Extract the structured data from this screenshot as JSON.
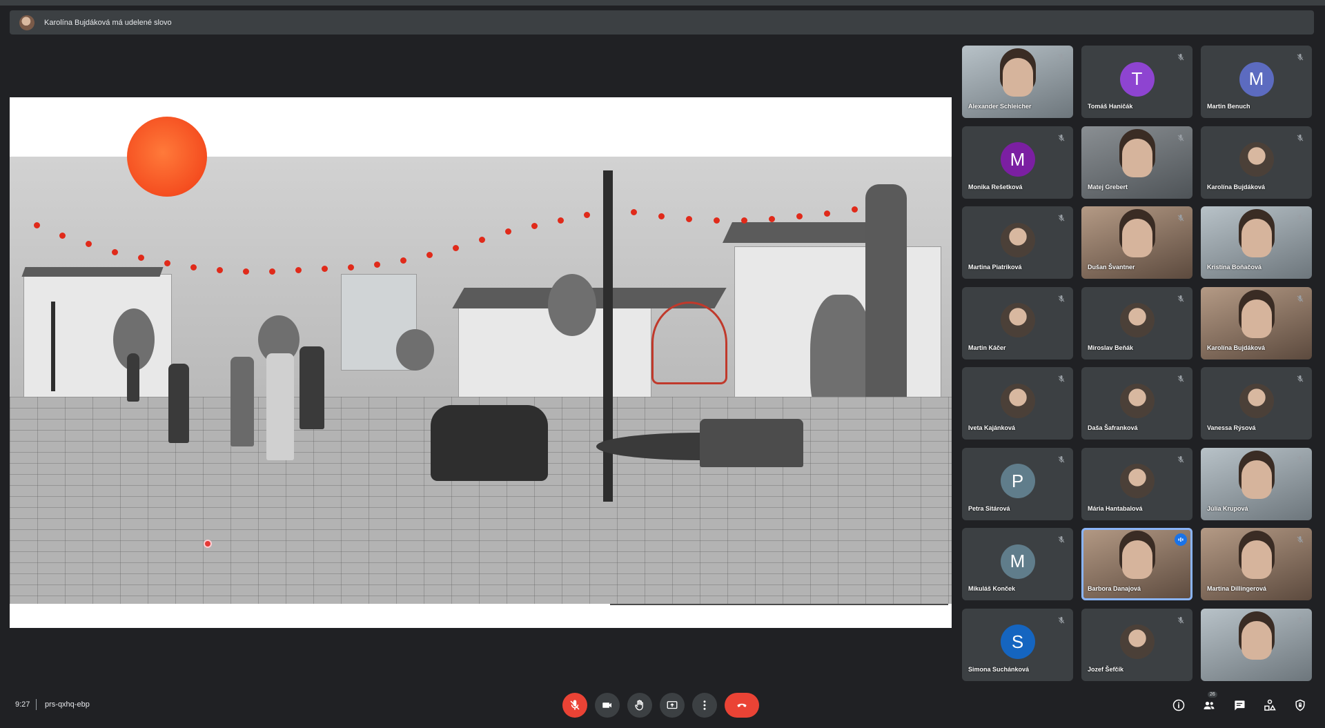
{
  "banner": {
    "text": "Karolína Bujdáková má udelené slovo"
  },
  "participants": [
    {
      "name": "Alexander Schleicher",
      "type": "video",
      "variant": "cool"
    },
    {
      "name": "Tomáš Haničák",
      "type": "initial",
      "initial": "T",
      "color": "#8e44d1"
    },
    {
      "name": "Martin Benuch",
      "type": "initial",
      "initial": "M",
      "color": "#5c6bc0"
    },
    {
      "name": "Monika Rešetková",
      "type": "initial",
      "initial": "M",
      "color": "#7b1fa2"
    },
    {
      "name": "Matej Grebert",
      "type": "video",
      "variant": ""
    },
    {
      "name": "Karolína Bujdáková",
      "type": "photo"
    },
    {
      "name": "Martina Piatriková",
      "type": "photo"
    },
    {
      "name": "Dušan Švantner",
      "type": "video",
      "variant": "warm"
    },
    {
      "name": "Kristína Boňačová",
      "type": "video",
      "variant": "cool"
    },
    {
      "name": "Martin Káčer",
      "type": "photo"
    },
    {
      "name": "Miroslav Beňák",
      "type": "photo"
    },
    {
      "name": "Karolína Bujdáková",
      "type": "video",
      "variant": "warm"
    },
    {
      "name": "Iveta Kajánková",
      "type": "photo"
    },
    {
      "name": "Daša Šafranková",
      "type": "photo"
    },
    {
      "name": "Vanessa Rýsová",
      "type": "photo"
    },
    {
      "name": "Petra Sitárová",
      "type": "initial",
      "initial": "P",
      "color": "#607d8b"
    },
    {
      "name": "Mária Hantabalová",
      "type": "photo"
    },
    {
      "name": "Júlia Krupová",
      "type": "video",
      "variant": "cool"
    },
    {
      "name": "Mikuláš Konček",
      "type": "initial",
      "initial": "M",
      "color": "#607d8b"
    },
    {
      "name": "Barbora Danajová",
      "type": "video",
      "variant": "warm",
      "active": true
    },
    {
      "name": "Martina Dillingerová",
      "type": "video",
      "variant": "warm"
    },
    {
      "name": "Simona Suchánková",
      "type": "initial",
      "initial": "S",
      "color": "#1565c0"
    },
    {
      "name": "Jozef Šefčík",
      "type": "photo"
    },
    {
      "name": "",
      "type": "video",
      "variant": "cool"
    }
  ],
  "meeting": {
    "time": "9:27",
    "code": "prs-qxhq-ebp",
    "participant_count": "26"
  },
  "controls": [
    {
      "name": "microphone-off-button",
      "icon": "mic-off-icon"
    },
    {
      "name": "camera-button",
      "icon": "camera-icon"
    },
    {
      "name": "raise-hand-button",
      "icon": "hand-icon"
    },
    {
      "name": "present-button",
      "icon": "present-icon"
    },
    {
      "name": "more-options-button",
      "icon": "more-vert-icon"
    },
    {
      "name": "leave-call-button",
      "icon": "phone-hangup-icon"
    }
  ],
  "right_tools": [
    {
      "name": "meeting-details-button",
      "icon": "info-icon"
    },
    {
      "name": "people-button",
      "icon": "people-icon"
    },
    {
      "name": "chat-button",
      "icon": "chat-icon"
    },
    {
      "name": "activities-button",
      "icon": "shapes-icon"
    },
    {
      "name": "host-controls-button",
      "icon": "lock-shield-icon"
    }
  ],
  "colors": {
    "bg": "#202124",
    "tile": "#3c4043",
    "danger": "#ea4335",
    "accent": "#8ab4f8"
  }
}
